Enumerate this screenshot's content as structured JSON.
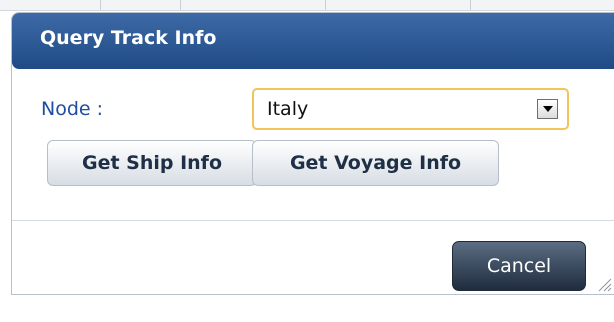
{
  "dialog": {
    "title": "Query Track Info",
    "node_label": "Node :",
    "node_select": {
      "selected": "Italy"
    },
    "buttons": {
      "ship": "Get Ship Info",
      "voyage": "Get Voyage Info",
      "cancel": "Cancel"
    }
  },
  "colors": {
    "title_bar": "#2f5b95",
    "label_text": "#1f4ea0",
    "select_border": "#f2c45a",
    "cancel_button": "#2c3a4e"
  }
}
